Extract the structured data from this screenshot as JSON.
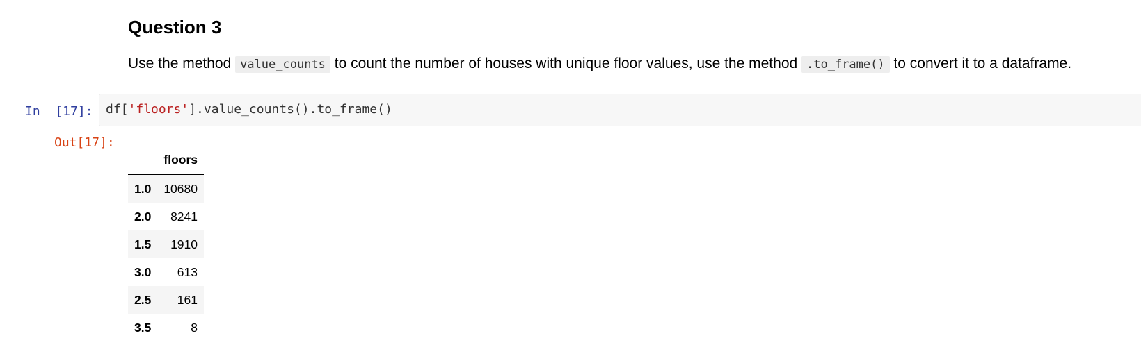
{
  "markdown": {
    "heading": "Question 3",
    "paragraph": {
      "text_1": "Use the method ",
      "code_1": "value_counts",
      "text_2": " to count the number of houses with unique floor values, use the method ",
      "code_2": ".to_frame()",
      "text_3": " to convert it to a dataframe."
    }
  },
  "code_cell": {
    "in_prompt": "In  [17]:",
    "code_pre": "df[",
    "code_string": "'floors'",
    "code_post": "].value_counts().to_frame()",
    "out_prompt": "Out[17]:"
  },
  "dataframe": {
    "index_header": "",
    "column_header": "floors",
    "rows": [
      {
        "index": "1.0",
        "value": "10680"
      },
      {
        "index": "2.0",
        "value": "8241"
      },
      {
        "index": "1.5",
        "value": "1910"
      },
      {
        "index": "3.0",
        "value": "613"
      },
      {
        "index": "2.5",
        "value": "161"
      },
      {
        "index": "3.5",
        "value": "8"
      }
    ]
  },
  "colors": {
    "in_prompt": "#303f9f",
    "out_prompt": "#d84315",
    "string_literal": "#ba2121",
    "input_background": "#f7f7f7"
  }
}
